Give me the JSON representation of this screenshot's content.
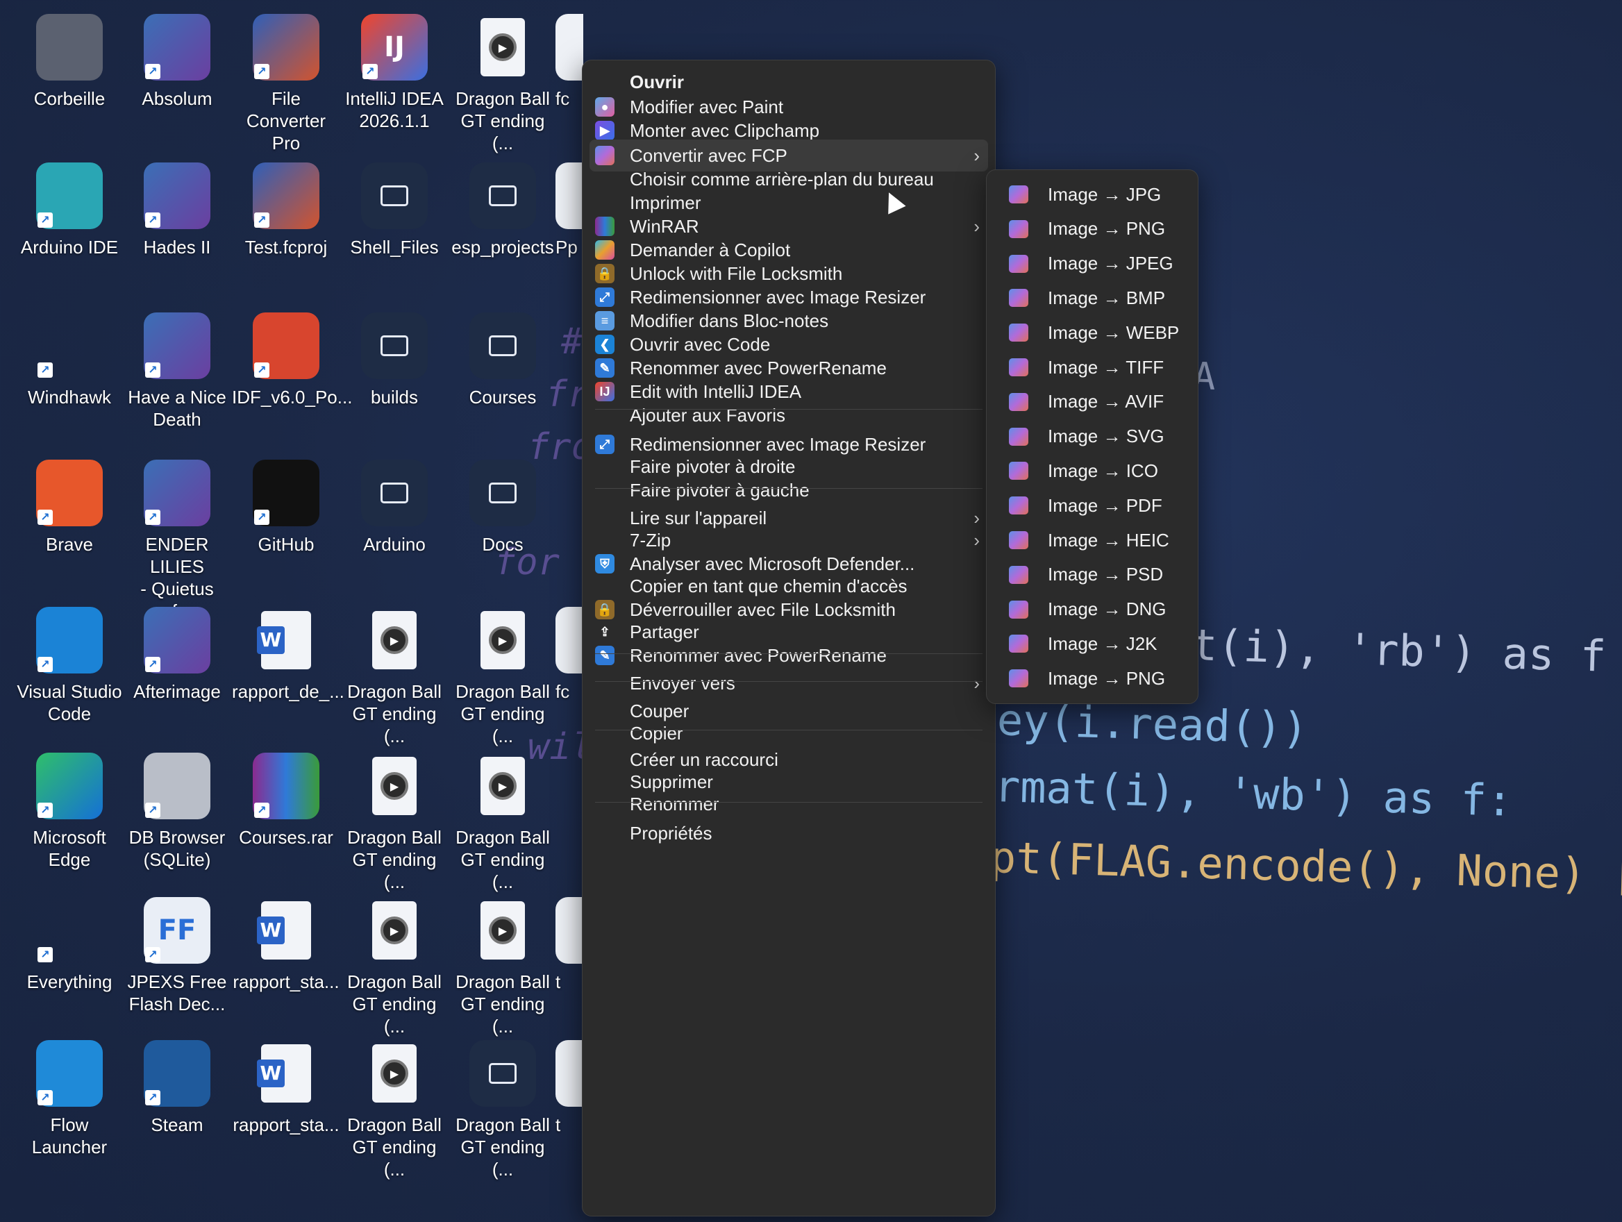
{
  "desktop": {
    "icons": [
      {
        "label": "Corbeille",
        "icon": "recycle-bin-icon"
      },
      {
        "label": "Absolum",
        "icon": "game-icon"
      },
      {
        "label": "File Converter\nPro",
        "icon": "converter-icon"
      },
      {
        "label": "IntelliJ IDEA\n2026.1.1",
        "icon": "intellij-icon",
        "badge": "IJ"
      },
      {
        "label": "Dragon Ball\nGT ending (...",
        "icon": "video-file-icon"
      },
      {
        "label": "fc",
        "icon": "file-icon"
      },
      {
        "label": "Arduino IDE",
        "icon": "arduino-icon"
      },
      {
        "label": "Hades II",
        "icon": "game-icon"
      },
      {
        "label": "Test.fcproj",
        "icon": "converter-icon"
      },
      {
        "label": "Shell_Files",
        "icon": "folder-icon"
      },
      {
        "label": "esp_projects",
        "icon": "folder-icon"
      },
      {
        "label": "Pp",
        "icon": "file-icon"
      },
      {
        "label": "Windhawk",
        "icon": "windhawk-icon"
      },
      {
        "label": "Have a Nice\nDeath",
        "icon": "game-icon"
      },
      {
        "label": "IDF_v6.0_Po...",
        "icon": "idf-icon"
      },
      {
        "label": "builds",
        "icon": "folder-icon"
      },
      {
        "label": "Courses",
        "icon": "folder-icon"
      },
      {
        "label": "Brave",
        "icon": "brave-icon"
      },
      {
        "label": "ENDER LILIES\n- Quietus of...",
        "icon": "game-icon"
      },
      {
        "label": "GitHub",
        "icon": "github-icon"
      },
      {
        "label": "Arduino",
        "icon": "folder-icon"
      },
      {
        "label": "Docs",
        "icon": "folder-icon"
      },
      {
        "label": "Visual Studio\nCode",
        "icon": "vscode-icon"
      },
      {
        "label": "Afterimage",
        "icon": "game-icon"
      },
      {
        "label": "rapport_de_...",
        "icon": "word-file-icon"
      },
      {
        "label": "Dragon Ball\nGT ending (...",
        "icon": "video-file-icon"
      },
      {
        "label": "Dragon Ball\nGT ending (...",
        "icon": "video-file-icon"
      },
      {
        "label": "fc",
        "icon": "file-icon"
      },
      {
        "label": "Microsoft\nEdge",
        "icon": "edge-icon"
      },
      {
        "label": "DB Browser\n(SQLite)",
        "icon": "database-icon"
      },
      {
        "label": "Courses.rar",
        "icon": "winrar-icon"
      },
      {
        "label": "Dragon Ball\nGT ending (...",
        "icon": "video-file-icon"
      },
      {
        "label": "Dragon Ball\nGT ending (...",
        "icon": "video-file-icon"
      },
      {
        "label": "Everything",
        "icon": "search-icon"
      },
      {
        "label": "JPEXS Free\nFlash Dec...",
        "icon": "ffdec-icon",
        "badge": "FF"
      },
      {
        "label": "rapport_sta...",
        "icon": "word-file-icon"
      },
      {
        "label": "Dragon Ball\nGT ending (...",
        "icon": "video-file-icon"
      },
      {
        "label": "Dragon Ball\nGT ending (...",
        "icon": "video-file-icon"
      },
      {
        "label": "t",
        "icon": "file-icon"
      },
      {
        "label": "Flow\nLauncher",
        "icon": "flow-launcher-icon"
      },
      {
        "label": "Steam",
        "icon": "steam-icon"
      },
      {
        "label": "rapport_sta...",
        "icon": "word-file-icon"
      },
      {
        "label": "Dragon Ball\nGT ending (...",
        "icon": "video-file-icon"
      },
      {
        "label": "Dragon Ball\nGT ending (...",
        "icon": "document-file-icon"
      },
      {
        "label": "t",
        "icon": "file-icon"
      }
    ]
  },
  "context_menu": {
    "items": [
      {
        "label": "Ouvrir",
        "icon": "",
        "bold": true
      },
      {
        "label": "Modifier avec Paint",
        "icon": "paint-icon"
      },
      {
        "label": "Monter avec Clipchamp",
        "icon": "clipchamp-icon"
      },
      {
        "label": "Convertir avec FCP",
        "icon": "converter-icon",
        "submenu": true,
        "hovered": true
      },
      {
        "label": "Choisir comme arrière-plan du bureau",
        "icon": ""
      },
      {
        "label": "Imprimer",
        "icon": ""
      },
      {
        "label": "WinRAR",
        "icon": "winrar-icon",
        "submenu": true
      },
      {
        "label": "Demander à Copilot",
        "icon": "copilot-icon"
      },
      {
        "label": "Unlock with File Locksmith",
        "icon": "lock-icon"
      },
      {
        "label": "Redimensionner avec Image Resizer",
        "icon": "image-resizer-icon"
      },
      {
        "label": "Modifier dans Bloc-notes",
        "icon": "notepad-icon"
      },
      {
        "label": "Ouvrir avec Code",
        "icon": "vscode-icon"
      },
      {
        "label": "Renommer avec PowerRename",
        "icon": "powerrename-icon"
      },
      {
        "label": "Edit with IntelliJ IDEA",
        "icon": "intellij-icon"
      },
      {
        "label": "Ajouter aux Favoris",
        "icon": ""
      },
      {
        "label": "Redimensionner avec Image Resizer",
        "icon": "image-resizer-icon"
      },
      {
        "label": "Faire pivoter à droite",
        "icon": ""
      },
      {
        "label": "Faire pivoter à gauche",
        "icon": ""
      },
      {
        "label": "Lire sur l'appareil",
        "icon": "",
        "submenu": true
      },
      {
        "label": "7-Zip",
        "icon": "",
        "submenu": true
      },
      {
        "label": "Analyser avec Microsoft Defender...",
        "icon": "defender-shield-icon"
      },
      {
        "label": "Copier en tant que chemin d'accès",
        "icon": ""
      },
      {
        "label": "Déverrouiller avec File Locksmith",
        "icon": "lock-icon"
      },
      {
        "label": "Partager",
        "icon": "share-icon"
      },
      {
        "label": "Renommer avec PowerRename",
        "icon": "powerrename-icon"
      },
      {
        "label": "Envoyer vers",
        "icon": "",
        "submenu": true
      },
      {
        "label": "Couper",
        "icon": ""
      },
      {
        "label": "Copier",
        "icon": ""
      },
      {
        "label": "Créer un raccourci",
        "icon": ""
      },
      {
        "label": "Supprimer",
        "icon": ""
      },
      {
        "label": "Renommer",
        "icon": ""
      },
      {
        "label": "Propriétés",
        "icon": ""
      }
    ]
  },
  "submenu": {
    "items": [
      "Image → JPG",
      "Image → PNG",
      "Image → JPEG",
      "Image → BMP",
      "Image → WEBP",
      "Image → TIFF",
      "Image → AVIF",
      "Image → SVG",
      "Image → ICO",
      "Image → PDF",
      "Image → HEIC",
      "Image → PSD",
      "Image → DNG",
      "Image → J2K",
      "Image → PNG"
    ]
  },
  "wallpaper_code": {
    "lines": [
      "t(i), 'rb') as f",
      "ey(i.read())",
      "rmat(i), 'wb') as f:",
      "pt(FLAG.encode(), None) ["
    ],
    "fragments": [
      "#",
      "fr",
      "fro",
      "for",
      "w",
      "wil",
      "A"
    ]
  },
  "colors": {
    "menu_bg": "#2b2b2b",
    "menu_hover": "#3b3b3b",
    "desktop_bg": "#1c2a4a",
    "accent": "#1f6fd1"
  }
}
